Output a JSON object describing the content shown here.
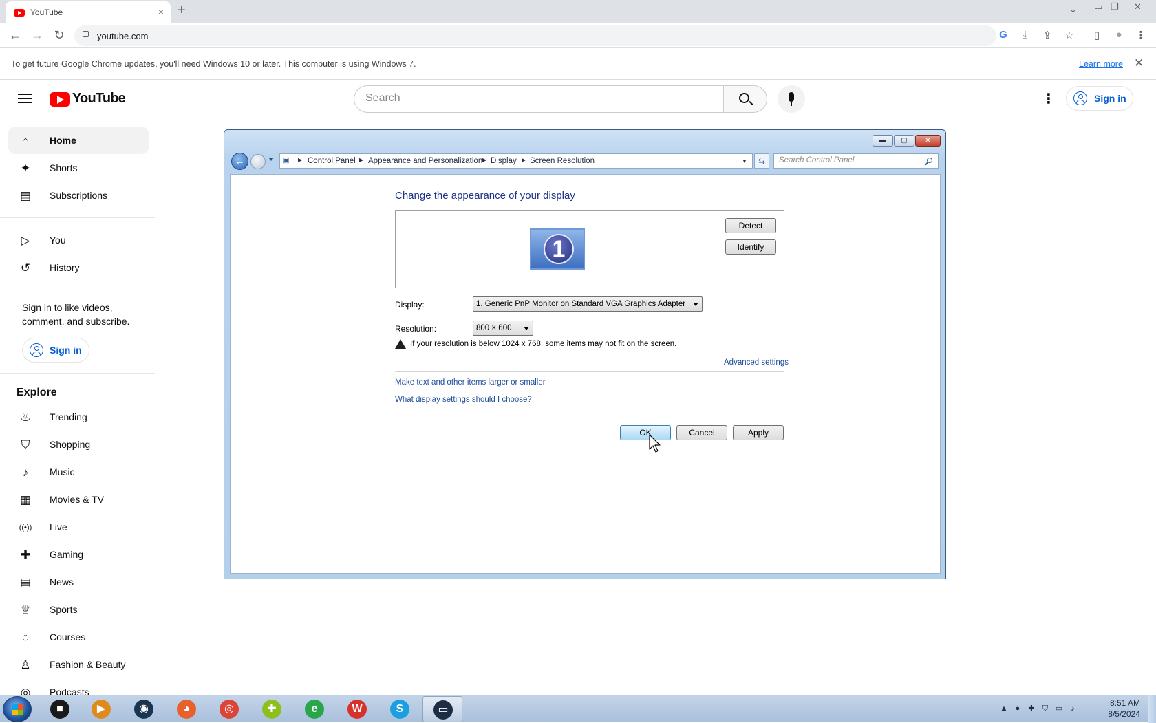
{
  "browser": {
    "tab": {
      "title": "YouTube",
      "favicon": "youtube-favicon-icon",
      "close": "×"
    },
    "new_tab": "+",
    "window_controls": {
      "list": "⌄",
      "minimize": "▭",
      "restore": "❐",
      "close": "✕"
    },
    "nav": {
      "back": "←",
      "forward": "→",
      "reload": "↻"
    },
    "url": "youtube.com",
    "toolbar_icons": {
      "google_lens": "G",
      "install": "⤓",
      "share": "⇪",
      "bookmark": "☆",
      "side_panel": "▯",
      "profile": "●",
      "menu": "⋮"
    },
    "infobar": {
      "message": "To get future Google Chrome updates, you'll need Windows 10 or later. This computer is using Windows 7.",
      "link": "Learn more",
      "close": "✕"
    }
  },
  "youtube": {
    "logo_text": "YouTube",
    "search_placeholder": "Search",
    "more_options": "⋮",
    "sign_in": "Sign in",
    "sidebar": {
      "primary": [
        {
          "label": "Home",
          "icon": "⌂"
        },
        {
          "label": "Shorts",
          "icon": "✦"
        },
        {
          "label": "Subscriptions",
          "icon": "▤"
        }
      ],
      "you": [
        {
          "label": "You",
          "icon": "▷"
        },
        {
          "label": "History",
          "icon": "↺"
        }
      ],
      "signin_prompt": "Sign in to like videos, comment, and subscribe.",
      "signin_button": "Sign in",
      "explore_title": "Explore",
      "explore": [
        {
          "label": "Trending",
          "icon": "♨"
        },
        {
          "label": "Shopping",
          "icon": "⛉"
        },
        {
          "label": "Music",
          "icon": "♪"
        },
        {
          "label": "Movies & TV",
          "icon": "▦"
        },
        {
          "label": "Live",
          "icon": "((•))"
        },
        {
          "label": "Gaming",
          "icon": "✚"
        },
        {
          "label": "News",
          "icon": "▤"
        },
        {
          "label": "Sports",
          "icon": "♕"
        },
        {
          "label": "Courses",
          "icon": "◌"
        },
        {
          "label": "Fashion & Beauty",
          "icon": "♙"
        },
        {
          "label": "Podcasts",
          "icon": "◎"
        }
      ]
    }
  },
  "dialog": {
    "title_buttons": {
      "minimize": "▬",
      "maximize": "▢",
      "close": "✕"
    },
    "breadcrumbs": [
      "Control Panel",
      "Appearance and Personalization",
      "Display",
      "Screen Resolution"
    ],
    "search_placeholder": "Search Control Panel",
    "heading": "Change the appearance of your display",
    "monitor_number": "1",
    "detect": "Detect",
    "identify": "Identify",
    "display_label": "Display:",
    "display_value": "1. Generic PnP Monitor on Standard VGA Graphics Adapter",
    "resolution_label": "Resolution:",
    "resolution_value": "800 × 600",
    "warning": "If your resolution is below 1024 x 768, some items may not fit on the screen.",
    "advanced_link": "Advanced settings",
    "link_text_size": "Make text and other items larger or smaller",
    "link_help": "What display settings should I choose?",
    "ok": "OK",
    "cancel": "Cancel",
    "apply": "Apply"
  },
  "taskbar": {
    "apps": [
      {
        "name": "media-player",
        "glyph": "■",
        "color": "#1a1a1a"
      },
      {
        "name": "media-player-classic",
        "glyph": "▶",
        "color": "#e08a1e"
      },
      {
        "name": "steelseries",
        "glyph": "◉",
        "color": "#1b3550"
      },
      {
        "name": "firefox",
        "glyph": "◕",
        "color": "#e8612c"
      },
      {
        "name": "chrome",
        "glyph": "◎",
        "color": "#db4437"
      },
      {
        "name": "plus-app",
        "glyph": "✚",
        "color": "#8dbf1f"
      },
      {
        "name": "internet-explorer",
        "glyph": "e",
        "color": "#2aa64a"
      },
      {
        "name": "wps-office",
        "glyph": "W",
        "color": "#d6322b"
      },
      {
        "name": "skype",
        "glyph": "S",
        "color": "#1aa0e0"
      },
      {
        "name": "display-settings",
        "glyph": "▭",
        "color": "#1e2d44"
      }
    ],
    "tray": [
      "▲",
      "●",
      "✚",
      "⛉",
      "▭",
      "♪"
    ],
    "time": "8:51 AM",
    "date": "8/5/2024"
  }
}
